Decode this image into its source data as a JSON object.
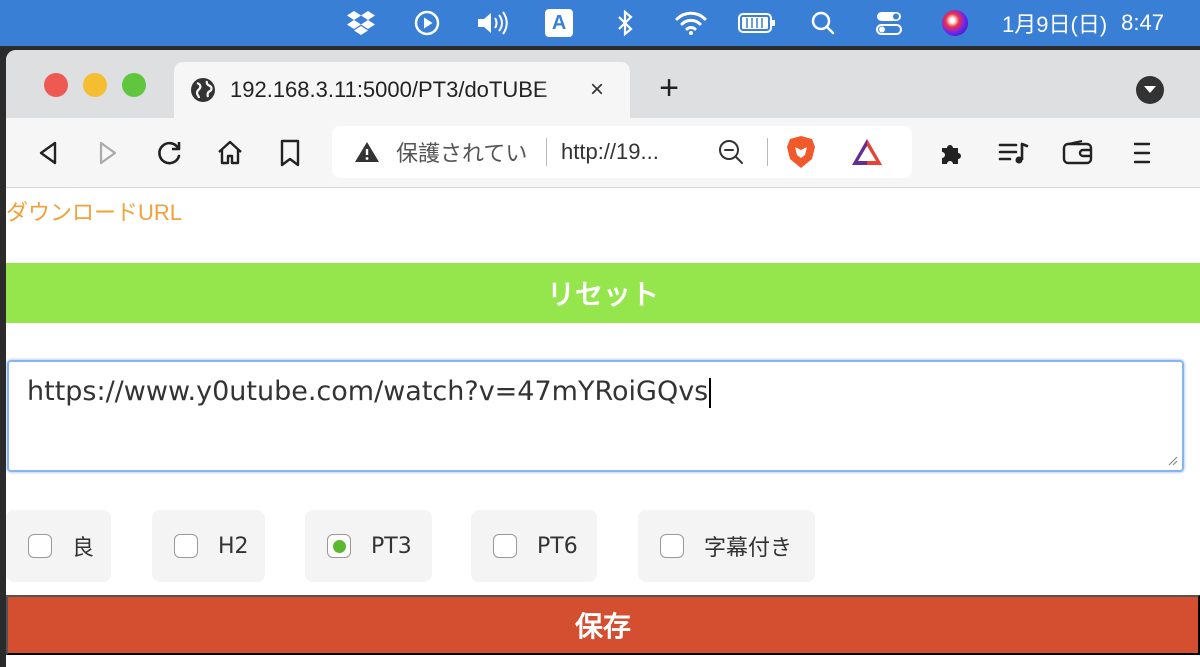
{
  "menubar": {
    "icons": [
      "dropbox-icon",
      "play-icon",
      "volume-icon",
      "input-method-icon",
      "bluetooth-icon",
      "wifi-icon",
      "battery-icon",
      "search-icon",
      "control-center-icon",
      "siri-icon"
    ],
    "ime_label": "A",
    "date": "1月9日(日)",
    "time": "8:47"
  },
  "tab": {
    "title": "192.168.3.11:5000/PT3/doTUBE",
    "close": "×",
    "new_tab": "+"
  },
  "urlbar": {
    "security_text": "保護されてい",
    "url_text": "http://19..."
  },
  "page": {
    "download_url_label": "ダウンロードURL",
    "reset_label": "リセット",
    "url_input_value": "https://www.y0utube.com/watch?v=47mYRoiGQvs",
    "options": [
      {
        "label": "良",
        "checked": false
      },
      {
        "label": "H2",
        "checked": false
      },
      {
        "label": "PT3",
        "checked": true
      },
      {
        "label": "PT6",
        "checked": false
      },
      {
        "label": "字幕付き",
        "checked": false
      }
    ],
    "save_label": "保存"
  },
  "colors": {
    "reset_bg": "#95e54d",
    "save_bg": "#d44e30",
    "download_link": "#f0a13a",
    "checked_accent": "#5cb82f"
  }
}
